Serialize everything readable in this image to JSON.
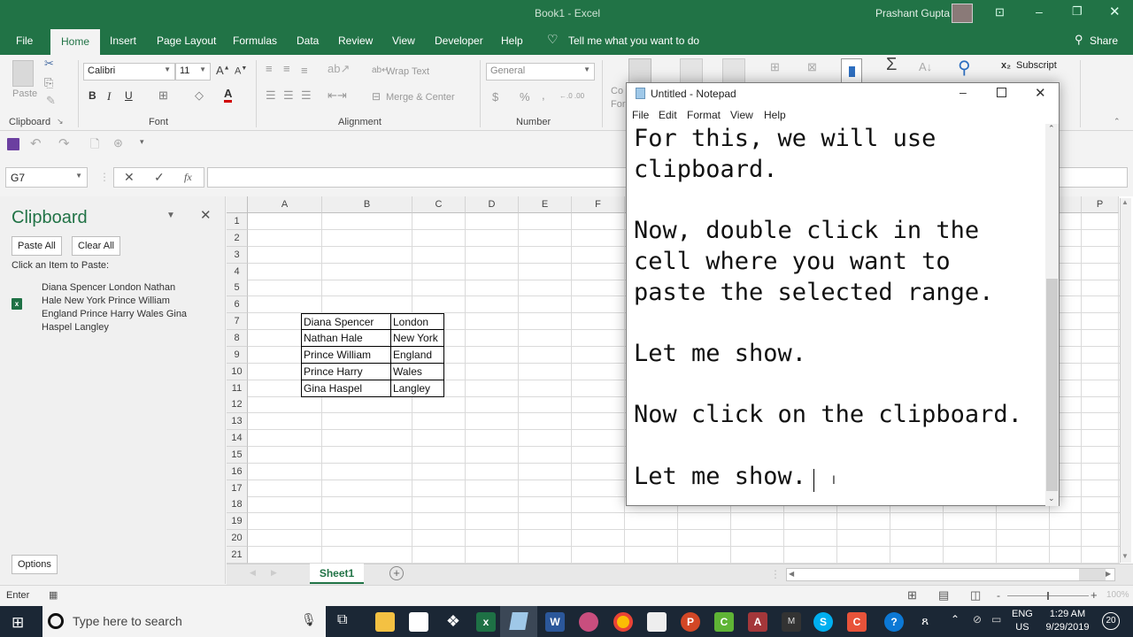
{
  "excel": {
    "title": "Book1  -  Excel",
    "user": "Prashant Gupta",
    "tabs": [
      "File",
      "Home",
      "Insert",
      "Page Layout",
      "Formulas",
      "Data",
      "Review",
      "View",
      "Developer",
      "Help"
    ],
    "active_tab": "Home",
    "tell_me": "Tell me what you want to do",
    "share": "Share",
    "ribbon": {
      "clipboard": {
        "label": "Clipboard",
        "paste": "Paste"
      },
      "font": {
        "label": "Font",
        "name": "Calibri",
        "size": "11",
        "bold": "B",
        "italic": "I",
        "underline": "U"
      },
      "alignment": {
        "label": "Alignment",
        "wrap_text": "Wrap Text",
        "merge_center": "Merge & Center"
      },
      "number": {
        "label": "Number",
        "format": "General",
        "currency": "$",
        "percent": "%",
        "comma": ","
      },
      "styles_partial": "Co\nFor",
      "font_extra": {
        "subscript": "Subscript"
      }
    },
    "name_box": "G7",
    "formula_value": "",
    "clipboard_pane": {
      "title": "Clipboard",
      "paste_all": "Paste All",
      "clear_all": "Clear All",
      "instruction": "Click an Item to Paste:",
      "items": [
        {
          "text": "Diana Spencer London Nathan Hale New York Prince William England Prince Harry Wales Gina Haspel Langley",
          "source_icon": "excel-icon"
        }
      ],
      "options": "Options"
    },
    "columns": [
      "A",
      "B",
      "C",
      "D",
      "E",
      "F",
      "P"
    ],
    "rows": [
      "1",
      "2",
      "3",
      "4",
      "5",
      "6",
      "7",
      "8",
      "9",
      "10",
      "11",
      "12",
      "13",
      "14",
      "15",
      "16",
      "17",
      "18",
      "19",
      "20",
      "21"
    ],
    "table": [
      {
        "row": "7",
        "B": "Diana Spencer",
        "C": "London"
      },
      {
        "row": "8",
        "B": "Nathan Hale",
        "C": "New York"
      },
      {
        "row": "9",
        "B": "Prince William",
        "C": "England"
      },
      {
        "row": "10",
        "B": "Prince Harry",
        "C": "Wales"
      },
      {
        "row": "11",
        "B": "Gina Haspel",
        "C": "Langley"
      }
    ],
    "sheet_tabs": [
      "Sheet1"
    ],
    "status_mode": "Enter",
    "zoom": "100%"
  },
  "notepad": {
    "title": "Untitled - Notepad",
    "menu": [
      "File",
      "Edit",
      "Format",
      "View",
      "Help"
    ],
    "content": "For this, we will use\nclipboard.\n\nNow, double click in the\ncell where you want to\npaste the selected range.\n\nLet me show.\n\nNow click on the clipboard.\n\nLet me show."
  },
  "taskbar": {
    "search_placeholder": "Type here to search",
    "lang_top": "ENG",
    "lang_bottom": "US",
    "time": "1:29 AM",
    "date": "9/29/2019",
    "notifications": "20"
  }
}
